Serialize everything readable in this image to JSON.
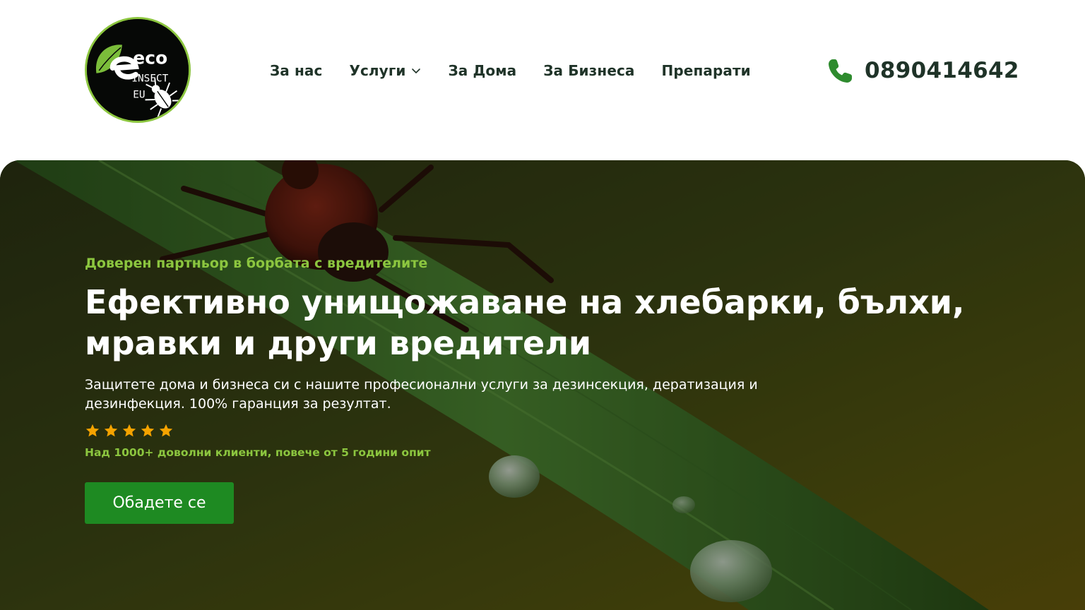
{
  "header": {
    "logo": {
      "icon": "leaf-beetle-logo",
      "wordmark_eco": "eco",
      "wordmark_insect": "INSECT",
      "wordmark_eu": "EU"
    },
    "nav": {
      "items": [
        {
          "label": "За нас"
        },
        {
          "label": "Услуги",
          "has_dropdown": true,
          "dropdown_icon": "chevron-down-icon"
        },
        {
          "label": "За Дома"
        },
        {
          "label": "За Бизнеса"
        },
        {
          "label": "Препарати"
        }
      ]
    },
    "phone": {
      "icon": "phone-icon",
      "number": "0890414642"
    }
  },
  "hero": {
    "tagline": "Доверен партньор в борбата с вредителите",
    "headline": "Ефективно унищожаване на хлебарки, бълхи, мравки и други вредители",
    "subtext": "Защитете дома и бизнеса си с нашите професионални услуги за дезинсекция, дератизация и дезинфекция. 100% гаранция за резултат.",
    "rating": {
      "stars": 5,
      "max": 5,
      "icon": "star-icon"
    },
    "trust_line": "Над 1000+ доволни клиенти, повече от 5 години опит",
    "cta_label": "Обадете се"
  },
  "colors": {
    "accent_green": "#8cc63f",
    "button_green": "#1e8a22",
    "star_orange": "#f5a300",
    "text_dark": "#1f3328",
    "phone_icon_green": "#2e8b2e"
  }
}
